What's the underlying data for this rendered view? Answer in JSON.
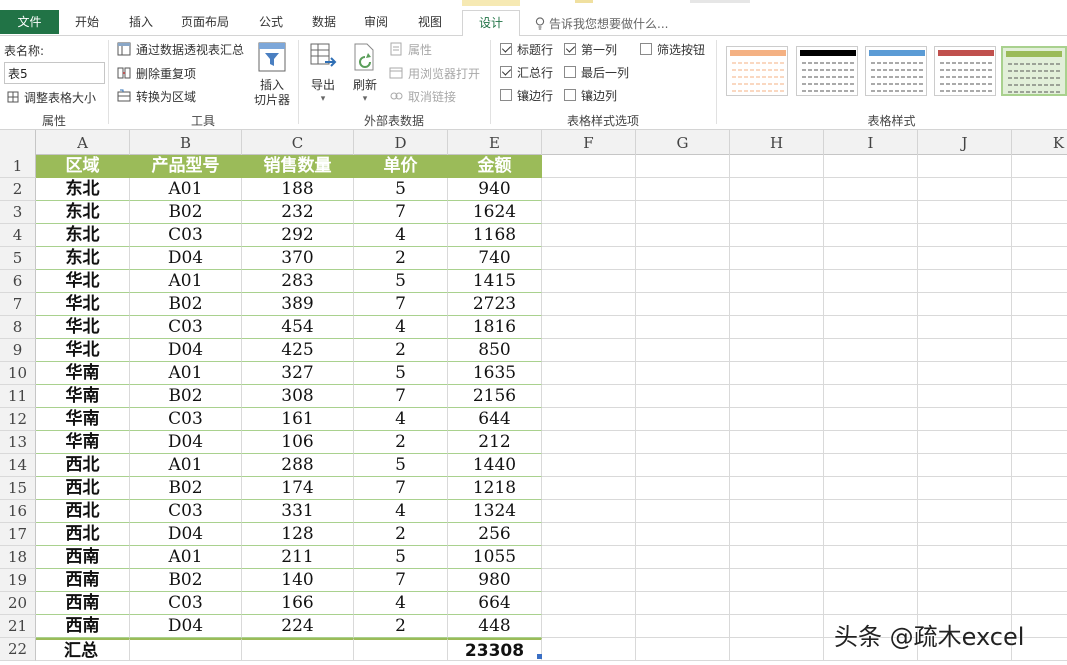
{
  "tabs": [
    {
      "label": "文件",
      "name": "tab-file"
    },
    {
      "label": "开始",
      "name": "tab-home"
    },
    {
      "label": "插入",
      "name": "tab-insert"
    },
    {
      "label": "页面布局",
      "name": "tab-page-layout"
    },
    {
      "label": "公式",
      "name": "tab-formulas"
    },
    {
      "label": "数据",
      "name": "tab-data"
    },
    {
      "label": "审阅",
      "name": "tab-review"
    },
    {
      "label": "视图",
      "name": "tab-view"
    },
    {
      "label": "设计",
      "name": "tab-design"
    }
  ],
  "tell_me": "告诉我您想要做什么...",
  "ribbon": {
    "properties": {
      "table_name_label": "表名称:",
      "table_name_value": "表5",
      "resize_table": "调整表格大小",
      "group_label": "属性"
    },
    "tools": {
      "summarize_pivot": "通过数据透视表汇总",
      "remove_duplicates": "删除重复项",
      "convert_to_range": "转换为区域",
      "insert_slicer_line1": "插入",
      "insert_slicer_line2": "切片器",
      "group_label": "工具"
    },
    "external": {
      "export": "导出",
      "refresh": "刷新",
      "properties": "属性",
      "open_in_browser": "用浏览器打开",
      "unlink": "取消链接",
      "group_label": "外部表数据"
    },
    "style_options": {
      "header_row": {
        "label": "标题行",
        "checked": true
      },
      "total_row": {
        "label": "汇总行",
        "checked": true
      },
      "banded_rows": {
        "label": "镶边行",
        "checked": false
      },
      "first_column": {
        "label": "第一列",
        "checked": true
      },
      "last_column": {
        "label": "最后一列",
        "checked": false
      },
      "banded_columns": {
        "label": "镶边列",
        "checked": false
      },
      "filter_button": {
        "label": "筛选按钮",
        "checked": false
      },
      "group_label": "表格样式选项"
    },
    "styles": {
      "group_label": "表格样式",
      "swatches": [
        {
          "name": "style-orange",
          "color": "#f4b183"
        },
        {
          "name": "style-black",
          "color": "#000000"
        },
        {
          "name": "style-blue",
          "color": "#5b9bd5"
        },
        {
          "name": "style-red",
          "color": "#c0504d"
        },
        {
          "name": "style-green-selected",
          "color": "#9bbb59"
        }
      ]
    }
  },
  "columns": [
    "A",
    "B",
    "C",
    "D",
    "E",
    "F",
    "G",
    "H",
    "I",
    "J",
    "K"
  ],
  "rows": [
    "1",
    "2",
    "3",
    "4",
    "5",
    "6",
    "7",
    "8",
    "9",
    "10",
    "11",
    "12",
    "13",
    "14",
    "15",
    "16",
    "17",
    "18",
    "19",
    "20",
    "21",
    "22"
  ],
  "table": {
    "headers": [
      "区域",
      "产品型号",
      "销售数量",
      "单价",
      "金额"
    ],
    "data": [
      [
        "东北",
        "A01",
        "188",
        "5",
        "940"
      ],
      [
        "东北",
        "B02",
        "232",
        "7",
        "1624"
      ],
      [
        "东北",
        "C03",
        "292",
        "4",
        "1168"
      ],
      [
        "东北",
        "D04",
        "370",
        "2",
        "740"
      ],
      [
        "华北",
        "A01",
        "283",
        "5",
        "1415"
      ],
      [
        "华北",
        "B02",
        "389",
        "7",
        "2723"
      ],
      [
        "华北",
        "C03",
        "454",
        "4",
        "1816"
      ],
      [
        "华北",
        "D04",
        "425",
        "2",
        "850"
      ],
      [
        "华南",
        "A01",
        "327",
        "5",
        "1635"
      ],
      [
        "华南",
        "B02",
        "308",
        "7",
        "2156"
      ],
      [
        "华南",
        "C03",
        "161",
        "4",
        "644"
      ],
      [
        "华南",
        "D04",
        "106",
        "2",
        "212"
      ],
      [
        "西北",
        "A01",
        "288",
        "5",
        "1440"
      ],
      [
        "西北",
        "B02",
        "174",
        "7",
        "1218"
      ],
      [
        "西北",
        "C03",
        "331",
        "4",
        "1324"
      ],
      [
        "西北",
        "D04",
        "128",
        "2",
        "256"
      ],
      [
        "西南",
        "A01",
        "211",
        "5",
        "1055"
      ],
      [
        "西南",
        "B02",
        "140",
        "7",
        "980"
      ],
      [
        "西南",
        "C03",
        "166",
        "4",
        "664"
      ],
      [
        "西南",
        "D04",
        "224",
        "2",
        "448"
      ]
    ],
    "total_row": [
      "汇总",
      "",
      "",
      "",
      "23308"
    ]
  },
  "colors": {
    "accent": "#217346",
    "table_header": "#9bbb59",
    "table_border": "#a9d18e"
  },
  "watermark": "头条 @疏木excel"
}
